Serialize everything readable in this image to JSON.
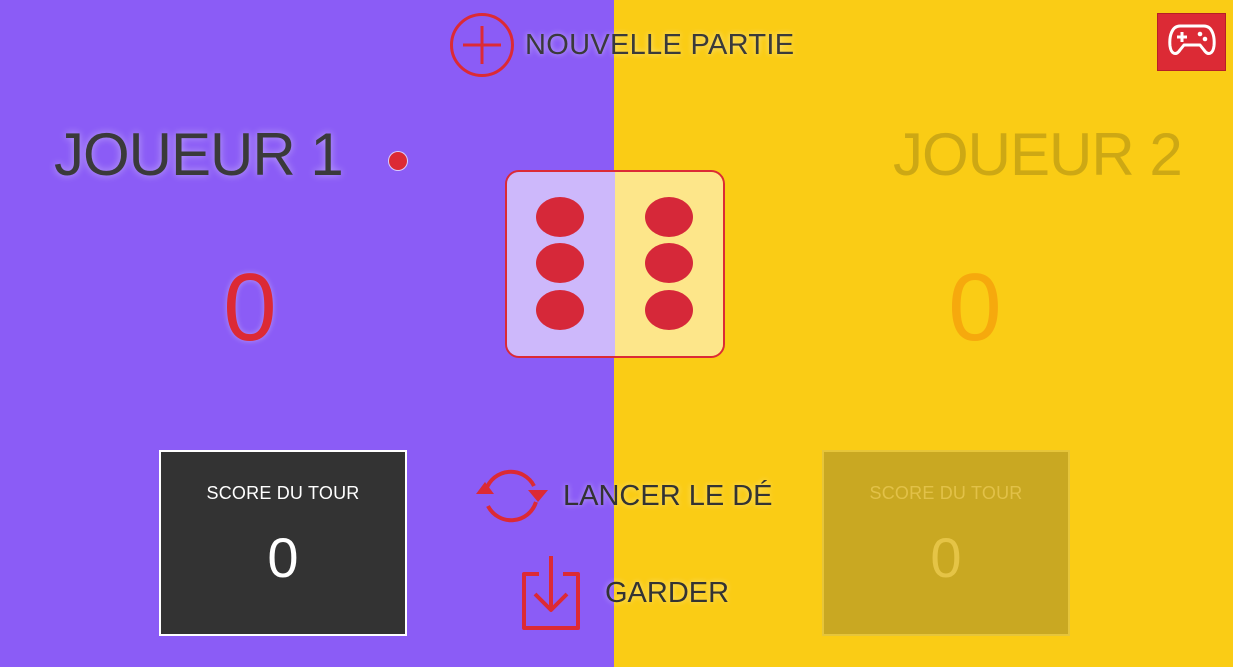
{
  "header": {
    "new_game_label": "NOUVELLE PARTIE",
    "menu_icon": "gamepad-icon"
  },
  "players": [
    {
      "name": "JOUEUR 1",
      "global_score": "0",
      "current_label": "SCORE DU TOUR",
      "current_score": "0",
      "active": true
    },
    {
      "name": "JOUEUR 2",
      "global_score": "0",
      "current_label": "SCORE DU TOUR",
      "current_score": "0",
      "active": false
    }
  ],
  "dice": {
    "value": 6
  },
  "actions": {
    "roll_label": "LANCER LE DÉ",
    "hold_label": "GARDER"
  },
  "colors": {
    "player1_bg": "#8b5cf6",
    "player2_bg": "#facc15",
    "accent": "#dc2a35"
  }
}
